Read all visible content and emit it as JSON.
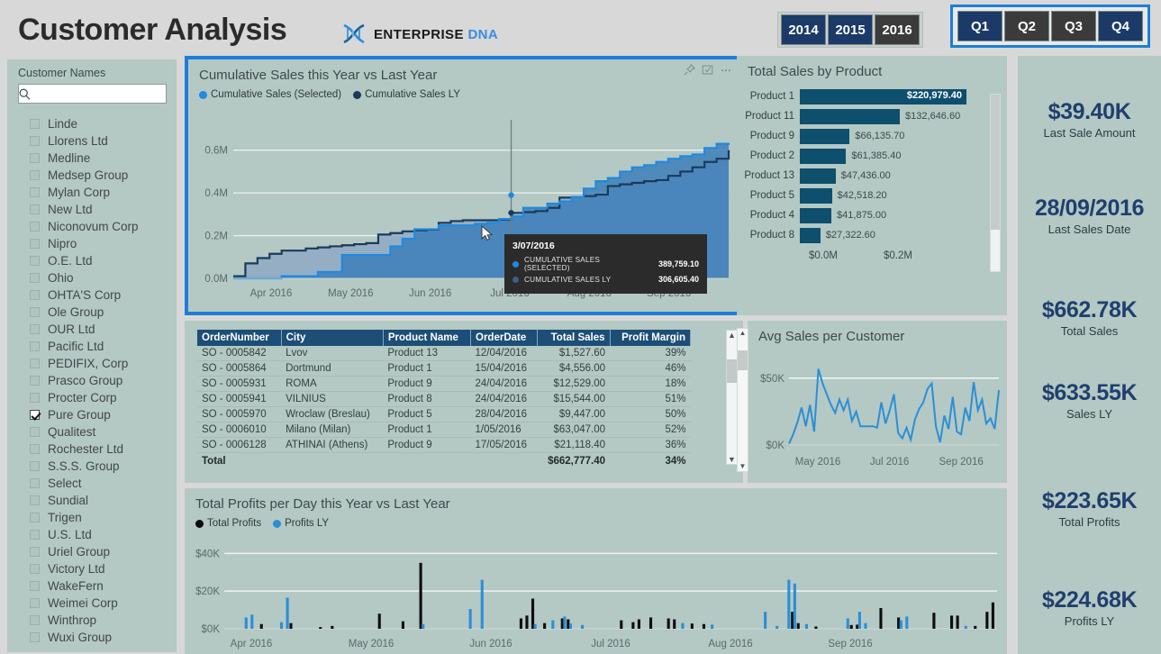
{
  "header": {
    "title": "Customer Analysis",
    "brand_primary": "ENTERPRISE",
    "brand_secondary": "DNA",
    "dna_icon": "dna-icon"
  },
  "slicers": {
    "years": [
      {
        "label": "2014",
        "selected": true
      },
      {
        "label": "2015",
        "selected": true
      },
      {
        "label": "2016",
        "selected": false
      }
    ],
    "quarters": [
      {
        "label": "Q1",
        "selected": true
      },
      {
        "label": "Q2",
        "selected": false
      },
      {
        "label": "Q3",
        "selected": false
      },
      {
        "label": "Q4",
        "selected": true
      }
    ],
    "quarter_highlight_color": "#1c7ed6",
    "selected_color": "#1b3a68",
    "unselected_color": "#3b3b3b"
  },
  "sidebar": {
    "title": "Customer Names",
    "search_placeholder": "",
    "search_value": "",
    "search_icon": "search-icon",
    "customers": [
      {
        "name": "Linde",
        "checked": false
      },
      {
        "name": "Llorens Ltd",
        "checked": false
      },
      {
        "name": "Medline",
        "checked": false
      },
      {
        "name": "Medsep Group",
        "checked": false
      },
      {
        "name": "Mylan Corp",
        "checked": false
      },
      {
        "name": "New Ltd",
        "checked": false
      },
      {
        "name": "Niconovum Corp",
        "checked": false
      },
      {
        "name": "Nipro",
        "checked": false
      },
      {
        "name": "O.E. Ltd",
        "checked": false
      },
      {
        "name": "Ohio",
        "checked": false
      },
      {
        "name": "OHTA'S Corp",
        "checked": false
      },
      {
        "name": "Ole Group",
        "checked": false
      },
      {
        "name": "OUR Ltd",
        "checked": false
      },
      {
        "name": "Pacific Ltd",
        "checked": false
      },
      {
        "name": "PEDIFIX, Corp",
        "checked": false
      },
      {
        "name": "Prasco Group",
        "checked": false
      },
      {
        "name": "Procter Corp",
        "checked": false
      },
      {
        "name": "Pure Group",
        "checked": true
      },
      {
        "name": "Qualitest",
        "checked": false
      },
      {
        "name": "Rochester Ltd",
        "checked": false
      },
      {
        "name": "S.S.S. Group",
        "checked": false
      },
      {
        "name": "Select",
        "checked": false
      },
      {
        "name": "Sundial",
        "checked": false
      },
      {
        "name": "Trigen",
        "checked": false
      },
      {
        "name": "U.S. Ltd",
        "checked": false
      },
      {
        "name": "Uriel Group",
        "checked": false
      },
      {
        "name": "Victory Ltd",
        "checked": false
      },
      {
        "name": "WakeFern",
        "checked": false
      },
      {
        "name": "Weimei Corp",
        "checked": false
      },
      {
        "name": "Winthrop",
        "checked": false
      },
      {
        "name": "Wuxi Group",
        "checked": false
      }
    ]
  },
  "cumulative_card": {
    "title": "Cumulative Sales this Year vs Last Year",
    "icons": [
      "pin-icon",
      "focus-mode-icon",
      "more-options-icon"
    ],
    "tooltip": {
      "date": "3/07/2016",
      "rows": [
        {
          "label": "CUMULATIVE SALES (SELECTED)",
          "value": "389,759.10",
          "color": "#1f8ae0"
        },
        {
          "label": "CUMULATIVE SALES LY",
          "value": "306,605.40",
          "color": "#3d5f8a"
        }
      ]
    }
  },
  "product_card": {
    "title": "Total Sales by Product"
  },
  "avg_card": {
    "title": "Avg Sales per Customer"
  },
  "profits_card": {
    "title": "Total Profits per Day this Year vs Last Year"
  },
  "orders_table": {
    "columns": [
      "OrderNumber",
      "City",
      "Product Name",
      "OrderDate",
      "Total Sales",
      "Profit Margin"
    ],
    "rows": [
      [
        "SO - 0005842",
        "Lvov",
        "Product 13",
        "12/04/2016",
        "$1,527.60",
        "39%"
      ],
      [
        "SO - 0005864",
        "Dortmund",
        "Product 1",
        "15/04/2016",
        "$4,556.00",
        "46%"
      ],
      [
        "SO - 0005931",
        "ROMA",
        "Product 9",
        "24/04/2016",
        "$12,529.00",
        "18%"
      ],
      [
        "SO - 0005941",
        "VILNIUS",
        "Product 8",
        "24/04/2016",
        "$15,544.00",
        "51%"
      ],
      [
        "SO - 0005970",
        "Wroclaw (Breslau)",
        "Product 5",
        "28/04/2016",
        "$9,447.00",
        "50%"
      ],
      [
        "SO - 0006010",
        "Milano (Milan)",
        "Product 1",
        "1/05/2016",
        "$63,047.00",
        "52%"
      ],
      [
        "SO - 0006128",
        "ATHINAI (Athens)",
        "Product 9",
        "17/05/2016",
        "$21,118.40",
        "36%"
      ]
    ],
    "total_row": {
      "label": "Total",
      "total_sales": "$662,777.40",
      "profit_margin": "34%"
    }
  },
  "kpis": [
    {
      "value": "$39.40K",
      "label": "Last Sale Amount"
    },
    {
      "value": "28/09/2016",
      "label": "Last Sales Date"
    },
    {
      "value": "$662.78K",
      "label": "Total Sales"
    },
    {
      "value": "$633.55K",
      "label": "Sales LY"
    },
    {
      "value": "$223.65K",
      "label": "Total Profits"
    },
    {
      "value": "$224.68K",
      "label": "Profits LY"
    }
  ],
  "chart_data": [
    {
      "type": "area",
      "name": "cumulative-sales",
      "title": "Cumulative Sales this Year vs Last Year",
      "xlabel": "",
      "ylabel": "",
      "ylim": [
        0,
        700000
      ],
      "ytick_labels": [
        "0.0M",
        "0.2M",
        "0.4M",
        "0.6M"
      ],
      "ytick_values": [
        0,
        200000,
        400000,
        600000
      ],
      "xtick_labels": [
        "Apr 2016",
        "May 2016",
        "Jun 2016",
        "Jul 2016",
        "Aug 2016",
        "Sep 2016"
      ],
      "grid": true,
      "legend": [
        "Cumulative Sales (Selected)",
        "Cumulative Sales LY"
      ],
      "legend_position": "top-left",
      "series": [
        {
          "name": "Cumulative Sales (Selected)",
          "color": "#1f8ae0",
          "values": [
            0,
            0,
            0,
            0,
            10000,
            10000,
            10000,
            30000,
            30000,
            110000,
            110000,
            110000,
            110000,
            150000,
            185000,
            230000,
            230000,
            248000,
            248000,
            248000,
            255000,
            260000,
            278000,
            289759,
            330000,
            330000,
            350000,
            360000,
            380000,
            420000,
            455000,
            470000,
            500000,
            520000,
            530000,
            545000,
            560000,
            572000,
            580000,
            610000,
            630000,
            633550
          ]
        },
        {
          "name": "Cumulative Sales LY",
          "color": "#1b3a5c",
          "values": [
            10000,
            70000,
            95000,
            115000,
            130000,
            130000,
            140000,
            145000,
            150000,
            155000,
            160000,
            165000,
            205000,
            212000,
            220000,
            225000,
            228000,
            260000,
            268000,
            272000,
            272000,
            272000,
            275000,
            306605,
            310000,
            315000,
            330000,
            378000,
            380000,
            385000,
            392000,
            432000,
            440000,
            447000,
            455000,
            460000,
            480000,
            500000,
            520000,
            545000,
            560000,
            600000
          ]
        }
      ],
      "tooltip": {
        "x": "3/07/2016",
        "values": [
          389759.1,
          306605.4
        ]
      }
    },
    {
      "type": "bar",
      "name": "total-sales-by-product",
      "title": "Total Sales by Product",
      "orientation": "horizontal",
      "categories": [
        "Product 1",
        "Product 11",
        "Product 9",
        "Product 2",
        "Product 13",
        "Product 5",
        "Product 4",
        "Product 8"
      ],
      "values": [
        220979.4,
        132646.6,
        66135.7,
        61385.4,
        47436.0,
        42518.2,
        41875.0,
        27322.6
      ],
      "value_labels": [
        "$220,979.40",
        "$132,646.60",
        "$66,135.70",
        "$61,385.40",
        "$47,436.00",
        "$42,518.20",
        "$41,875.00",
        "$27,322.60"
      ],
      "bar_color": "#0e4f6e",
      "xtick_labels": [
        "$0.0M",
        "$0.2M"
      ],
      "xlim": [
        0,
        260000
      ],
      "xlabel": "",
      "ylabel": "",
      "grid": false
    },
    {
      "type": "line",
      "name": "avg-sales-per-customer",
      "title": "Avg Sales per Customer",
      "color": "#2b8fd6",
      "ytick_labels": [
        "$0K",
        "$50K"
      ],
      "ylim": [
        0,
        62000
      ],
      "xtick_labels": [
        "May 2016",
        "Jul 2016",
        "Sep 2016"
      ],
      "grid": true,
      "values": [
        1000,
        8000,
        17000,
        28000,
        14000,
        30000,
        10000,
        57000,
        46000,
        38000,
        30000,
        24000,
        34000,
        26000,
        34000,
        18000,
        25000,
        14000,
        14000,
        14000,
        14000,
        13000,
        32000,
        16000,
        26000,
        38000,
        9000,
        5000,
        13000,
        4000,
        19000,
        27000,
        32000,
        42000,
        46000,
        14000,
        2000,
        22000,
        12000,
        36000,
        10000,
        8000,
        28000,
        18000,
        47000,
        26000,
        34000,
        16000,
        20000,
        12000,
        41000
      ]
    },
    {
      "type": "bar",
      "name": "total-profits-per-day",
      "title": "Total Profits per Day this Year vs Last Year",
      "legend": [
        "Total Profits",
        "Profits LY"
      ],
      "legend_colors": [
        "#0d0d0d",
        "#2b8fd6"
      ],
      "ytick_labels": [
        "$0K",
        "$20K",
        "$40K"
      ],
      "ytick_values": [
        0,
        20000,
        40000
      ],
      "ylim": [
        0,
        44000
      ],
      "xtick_labels": [
        "Apr 2016",
        "May 2016",
        "Jun 2016",
        "Jul 2016",
        "Aug 2016",
        "Sep 2016"
      ],
      "grid": true,
      "series": [
        {
          "name": "Total Profits",
          "color": "#0d0d0d",
          "values": [
            0,
            0,
            0,
            0,
            0,
            0,
            2500,
            0,
            0,
            0,
            0,
            3000,
            0,
            0,
            0,
            0,
            900,
            0,
            1500,
            0,
            0,
            0,
            0,
            0,
            0,
            0,
            8000,
            0,
            0,
            0,
            4000,
            0,
            0,
            35000,
            0,
            0,
            0,
            0,
            0,
            0,
            0,
            0,
            0,
            0,
            0,
            0,
            0,
            0,
            0,
            0,
            5500,
            7000,
            16000,
            0,
            3000,
            0,
            0,
            5500,
            5000,
            0,
            0,
            0,
            0,
            0,
            0,
            0,
            0,
            4500,
            0,
            3500,
            5000,
            0,
            6000,
            0,
            0,
            5500,
            5000,
            0,
            0,
            2800,
            0,
            2500,
            0,
            0,
            0,
            0,
            0,
            0,
            0,
            0,
            0,
            0,
            0,
            0,
            0,
            0,
            9000,
            3000,
            0,
            0,
            1200,
            0,
            0,
            0,
            0,
            0,
            2000,
            2200,
            0,
            0,
            0,
            11000,
            0,
            0,
            6000,
            0,
            0,
            0,
            0,
            0,
            8500,
            0,
            0,
            7000,
            7000,
            0,
            0,
            1500,
            0,
            9000,
            14000
          ]
        },
        {
          "name": "Profits LY",
          "color": "#2b8fd6",
          "values": [
            0,
            0,
            0,
            0,
            6000,
            7500,
            0,
            0,
            0,
            0,
            3500,
            16500,
            0,
            0,
            0,
            0,
            0,
            0,
            0,
            0,
            0,
            0,
            0,
            0,
            0,
            0,
            0,
            0,
            0,
            0,
            0,
            0,
            0,
            0,
            2500,
            0,
            0,
            0,
            0,
            0,
            0,
            0,
            10500,
            0,
            26000,
            0,
            0,
            0,
            0,
            0,
            0,
            0,
            0,
            2500,
            0,
            0,
            4500,
            0,
            6500,
            2800,
            0,
            2000,
            0,
            0,
            0,
            0,
            0,
            0,
            0,
            0,
            0,
            0,
            0,
            0,
            0,
            0,
            0,
            0,
            3000,
            0,
            0,
            0,
            0,
            2200,
            0,
            0,
            0,
            0,
            0,
            0,
            0,
            0,
            9000,
            0,
            1500,
            0,
            26000,
            24000,
            0,
            2500,
            0,
            0,
            0,
            0,
            0,
            0,
            5500,
            0,
            9000,
            3000,
            0,
            0,
            0,
            0,
            0,
            4500,
            6500,
            0,
            0,
            0,
            0,
            0,
            0,
            0,
            0,
            0,
            1500
          ]
        }
      ]
    }
  ]
}
